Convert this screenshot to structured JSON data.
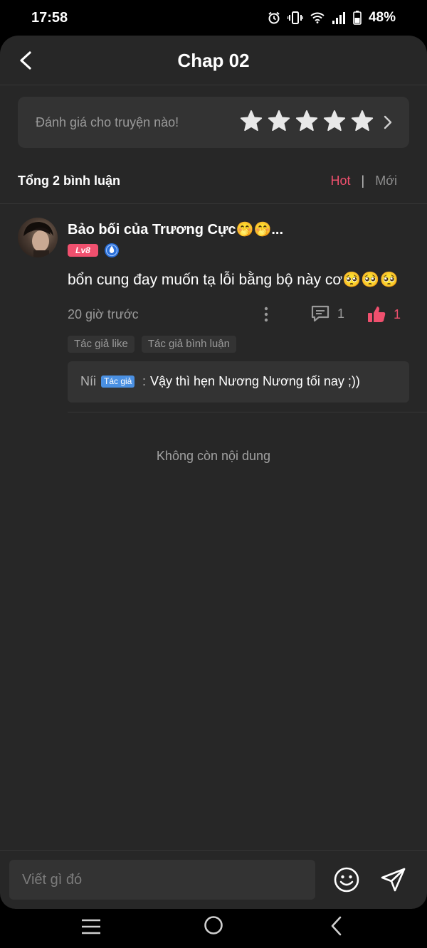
{
  "status_bar": {
    "time": "17:58",
    "battery": "48%",
    "icons": [
      "alarm-icon",
      "vibrate-icon",
      "wifi-icon",
      "signal-icon",
      "battery-icon"
    ]
  },
  "header": {
    "title": "Chap 02",
    "back_icon": "chevron-left-icon"
  },
  "rating": {
    "prompt": "Đánh giá cho truyện nào!",
    "stars": 5,
    "arrow_icon": "chevron-right-icon"
  },
  "comments": {
    "total_label": "Tổng 2 bình luận",
    "sort_hot": "Hot",
    "sort_separator": "|",
    "sort_new": "Mới",
    "items": [
      {
        "username": "Bảo bối của Trương Cực🤭🤭...",
        "level": "Lv8",
        "text": "bổn cung đay muốn tạ lỗi bằng bộ này cơ🥺🥺🥺",
        "time": "20 giờ trước",
        "reply_count": "1",
        "like_count": "1",
        "tags": [
          "Tác giả like",
          "Tác giả bình luận"
        ],
        "reply": {
          "author": "Níi",
          "badge": "Tác giả",
          "separator": ":",
          "text": "Vậy thì hẹn Nương Nương tối nay ;))"
        }
      }
    ],
    "end_message": "Không còn nội dung"
  },
  "input_bar": {
    "placeholder": "Viết gì đó",
    "emoji_icon": "smiley-icon",
    "send_icon": "send-icon"
  },
  "colors": {
    "accent": "#f0506e",
    "author_badge": "#4a90e2",
    "background": "#272727",
    "card": "#333333"
  }
}
